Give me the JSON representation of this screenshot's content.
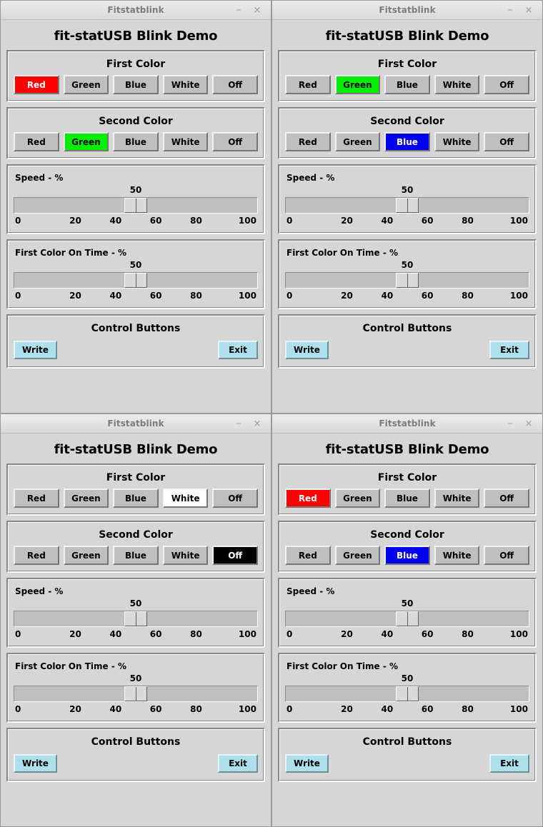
{
  "window": {
    "titlebar_title": "Fitstatblink",
    "minimize_label": "–",
    "close_label": "×"
  },
  "app": {
    "heading": "fit-statUSB Blink Demo"
  },
  "groups": {
    "first_color_title": "First Color",
    "second_color_title": "Second Color",
    "speed_title": "Speed - %",
    "on_time_title": "First Color On Time - %",
    "control_title": "Control Buttons"
  },
  "color_buttons": {
    "red": "Red",
    "green": "Green",
    "blue": "Blue",
    "white": "White",
    "off": "Off"
  },
  "control_buttons": {
    "write": "Write",
    "exit": "Exit"
  },
  "sliders": {
    "speed": {
      "value": "50",
      "value_num": 50,
      "min": 0,
      "max": 100,
      "ticks": [
        "0",
        "20",
        "40",
        "60",
        "80",
        "100"
      ]
    },
    "on_time": {
      "value": "50",
      "value_num": 50,
      "min": 0,
      "max": 100,
      "ticks": [
        "0",
        "20",
        "40",
        "60",
        "80",
        "100"
      ]
    }
  },
  "colors": {
    "red": "#fe0000",
    "green": "#02ee02",
    "blue": "#0000ee",
    "white": "#ffffff",
    "off": "#000000",
    "face": "#d6d6d6",
    "button_face": "#bfbfbf",
    "control_button": "#ade0ec",
    "titlebar_text": "#7c7c7c"
  },
  "windows": [
    {
      "id": "window-top-left",
      "first_color_selected": "red",
      "second_color_selected": "green"
    },
    {
      "id": "window-top-right",
      "first_color_selected": "green",
      "second_color_selected": "blue"
    },
    {
      "id": "window-bottom-left",
      "first_color_selected": "white",
      "second_color_selected": "off"
    },
    {
      "id": "window-bottom-right",
      "first_color_selected": "red",
      "second_color_selected": "blue"
    }
  ]
}
